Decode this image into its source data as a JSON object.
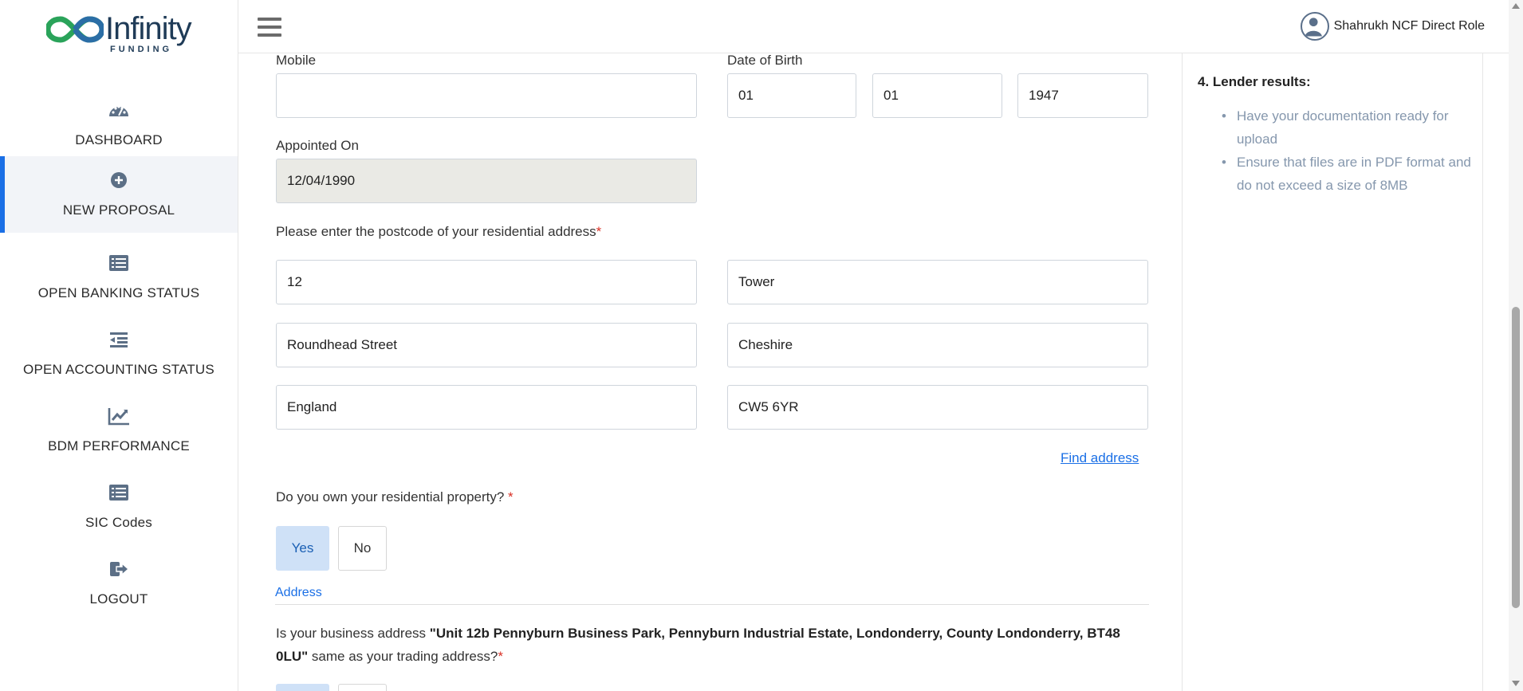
{
  "brand": {
    "name": "Infinity",
    "sub": "FUNDING"
  },
  "sidebar": {
    "items": [
      {
        "label": "DASHBOARD",
        "icon": "dashboard-icon"
      },
      {
        "label": "NEW PROPOSAL",
        "icon": "plus-circle-icon",
        "active": true
      },
      {
        "label": "OPEN BANKING STATUS",
        "icon": "list-icon"
      },
      {
        "label": "OPEN ACCOUNTING STATUS",
        "icon": "outdent-icon"
      },
      {
        "label": "BDM PERFORMANCE",
        "icon": "chart-line-icon"
      },
      {
        "label": "SIC Codes",
        "icon": "list-icon"
      },
      {
        "label": "LOGOUT",
        "icon": "logout-icon"
      }
    ]
  },
  "header": {
    "user_name": "Shahrukh NCF Direct Role"
  },
  "form": {
    "mobile_label": "Mobile",
    "mobile_value": "",
    "dob_label": "Date of Birth",
    "dob_day": "01",
    "dob_month": "01",
    "dob_year": "1947",
    "appointed_label": "Appointed On",
    "appointed_value": "12/04/1990",
    "postcode_label": "Please enter the postcode of your residential address",
    "required_mark": "*",
    "addr_line1": "12",
    "addr_line2": "Tower",
    "addr_street": "Roundhead Street",
    "addr_county": "Cheshire",
    "addr_country": "England",
    "addr_postcode": "CW5 6YR",
    "find_address": "Find address",
    "own_property_label": "Do you own your residential property?",
    "own_property_required": " *",
    "yes": "Yes",
    "no": "No",
    "address_section": "Address",
    "business_q_prefix": "Is your business address ",
    "business_address": "\"Unit 12b Pennyburn Business Park, Pennyburn Industrial Estate, Londonderry, County Londonderry, BT48 0LU\"",
    "business_q_suffix": " same as your trading address?"
  },
  "right_panel": {
    "title": "4. Lender results:",
    "items": [
      "Have your documentation ready for upload",
      "Ensure that files are in PDF format and do not exceed a size of 8MB"
    ]
  },
  "colors": {
    "accent": "#1a6fe6",
    "selected_bg": "#cfe1f7",
    "muted_text": "#8597ad"
  }
}
